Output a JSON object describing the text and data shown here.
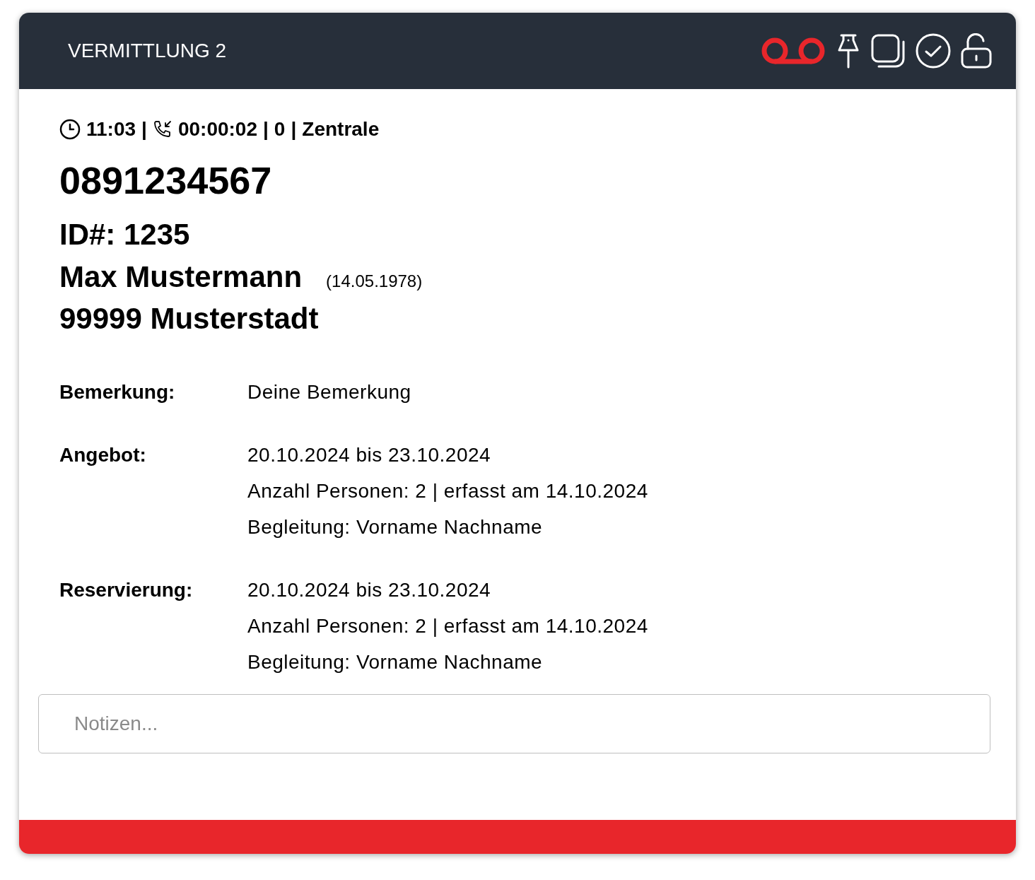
{
  "header": {
    "title": "VERMITTLUNG 2"
  },
  "call_info": {
    "time": "11:03",
    "separator_1": "|",
    "duration": "00:00:02",
    "separator_2": "|",
    "count": "0",
    "separator_3": "|",
    "line": "Zentrale"
  },
  "phone": "0891234567",
  "caller": {
    "id": "ID#: 1235",
    "name": "Max Mustermann",
    "birthdate": "(14.05.1978)",
    "city": "99999 Musterstadt"
  },
  "details": [
    {
      "label": "Bemerkung:",
      "lines": [
        "Deine Bemerkung"
      ]
    },
    {
      "label": "Angebot:",
      "lines": [
        "20.10.2024 bis 23.10.2024",
        "Anzahl Personen: 2 | erfasst am 14.10.2024",
        "Begleitung: Vorname Nachname"
      ]
    },
    {
      "label": "Reservierung:",
      "lines": [
        "20.10.2024 bis 23.10.2024",
        "Anzahl Personen: 2 | erfasst am 14.10.2024",
        "Begleitung: Vorname Nachname"
      ]
    }
  ],
  "notes": {
    "placeholder": "Notizen..."
  }
}
